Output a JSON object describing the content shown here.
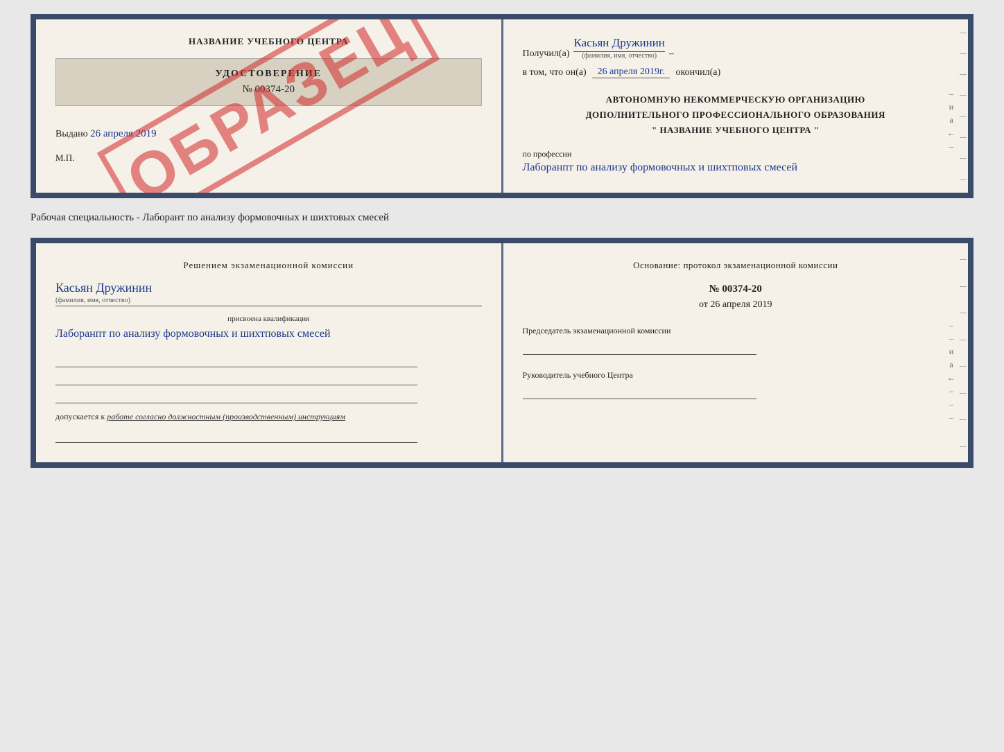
{
  "top_document": {
    "left": {
      "title": "НАЗВАНИЕ УЧЕБНОГО ЦЕНТРА",
      "certificate_title": "УДОСТОВЕРЕНИЕ",
      "certificate_number": "№ 00374-20",
      "obrazec": "ОБРАЗЕЦ",
      "issued_label": "Выдано",
      "issued_date_handwritten": "26 апреля 2019",
      "mp_label": "М.П."
    },
    "right": {
      "received_prefix": "Получил(а)",
      "received_name": "Касьян Дружинин",
      "fio_hint": "(фамилия, имя, отчество)",
      "date_prefix": "в том, что он(а)",
      "date_handwritten": "26 апреля 2019г.",
      "date_suffix": "окончил(а)",
      "org_line1": "АВТОНОМНУЮ НЕКОММЕРЧЕСКУЮ ОРГАНИЗАЦИЮ",
      "org_line2": "ДОПОЛНИТЕЛЬНОГО ПРОФЕССИОНАЛЬНОГО ОБРАЗОВАНИЯ",
      "org_line3": "\"  НАЗВАНИЕ УЧЕБНОГО ЦЕНТРА  \"",
      "profession_label": "по профессии",
      "profession_handwritten": "Лаборанпт по анализу формовочных и шихтповых смесей",
      "side_letters": "и а ←"
    }
  },
  "specialty_text": "Рабочая специальность - Лаборант по анализу формовочных и шихтовых смесей",
  "bottom_document": {
    "left": {
      "decision_title": "Решением  экзаменационной  комиссии",
      "person_name": "Касьян Дружинин",
      "fio_hint": "(фамилия, имя, отчество)",
      "qual_label": "присвоена квалификация",
      "qual_handwritten": "Лаборанпт по анализу формовочных и шихтповых смесей",
      "допуск_prefix": "допускается к",
      "допуск_text": "работе согласно должностным (производственным) инструкциям"
    },
    "right": {
      "osnov_title": "Основание: протокол экзаменационной  комиссии",
      "protocol_number": "№  00374-20",
      "protocol_date_prefix": "от",
      "protocol_date": "26 апреля 2019",
      "chairman_label": "Председатель экзаменационной комиссии",
      "head_label": "Руководитель учебного Центра",
      "side_letters": "и а ←"
    }
  }
}
